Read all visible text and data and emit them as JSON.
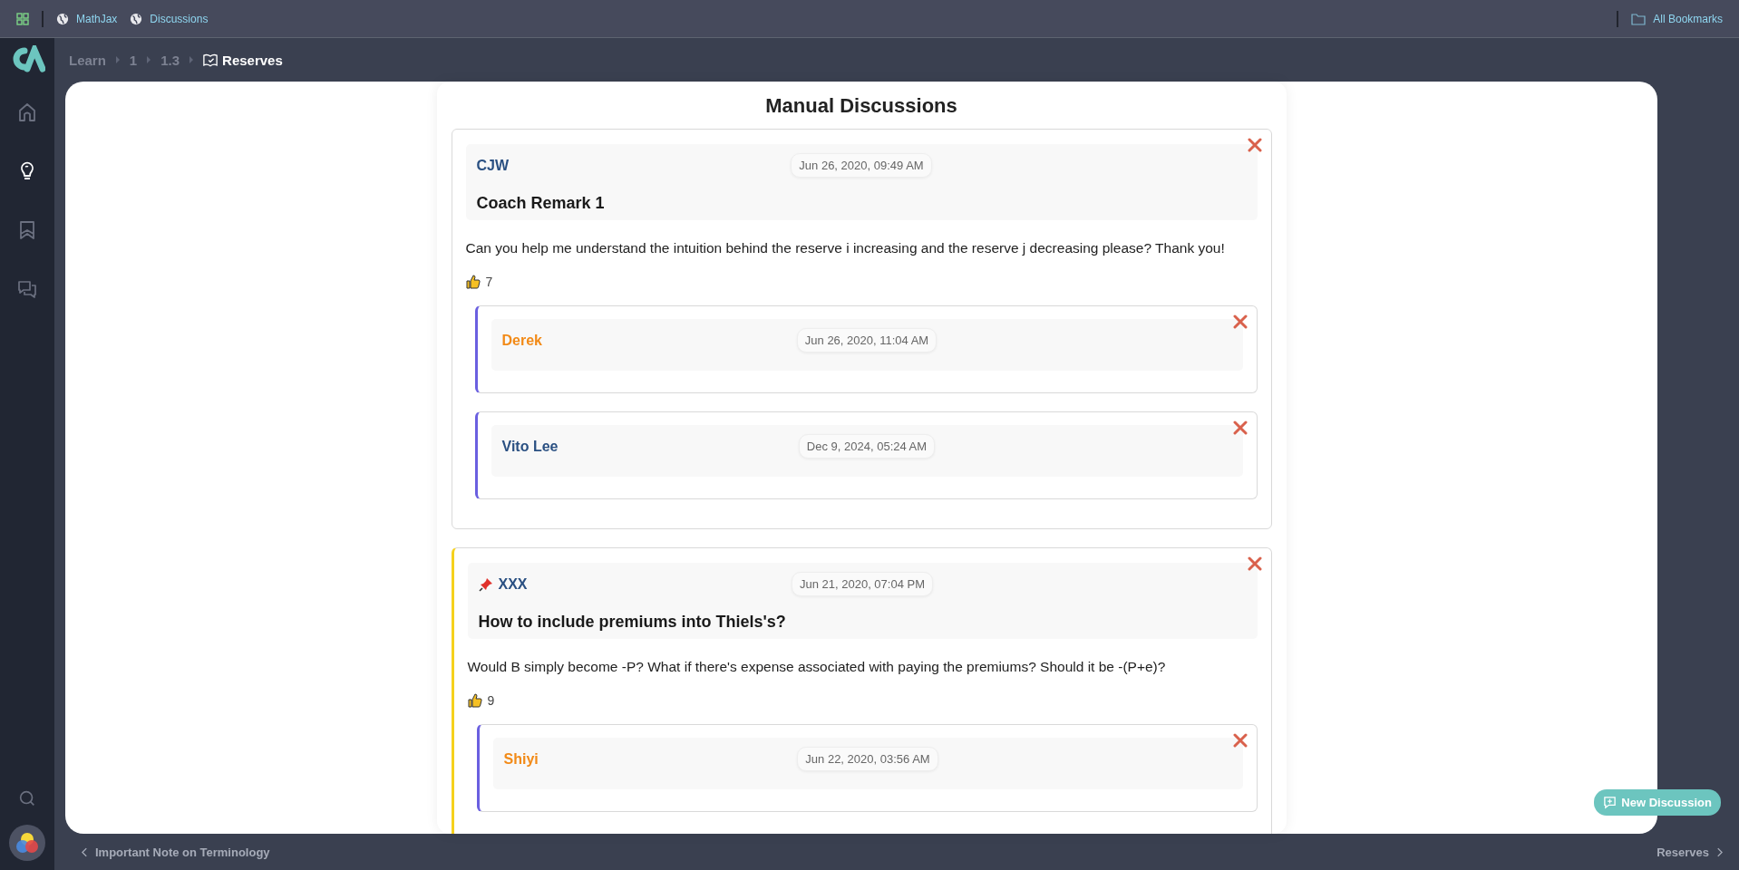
{
  "bookmarks_bar": {
    "items": [
      {
        "label": "MathJax"
      },
      {
        "label": "Discussions"
      }
    ],
    "all_bookmarks": "All Bookmarks"
  },
  "sidebar": {
    "items": [
      {
        "kind": "home",
        "selected": false
      },
      {
        "kind": "bulb",
        "selected": true
      },
      {
        "kind": "bookmark",
        "selected": false
      },
      {
        "kind": "chat",
        "selected": false
      }
    ]
  },
  "breadcrumb": {
    "items": [
      "Learn",
      "1",
      "1.3"
    ],
    "current": "Reserves"
  },
  "title": "Manual Discussions",
  "posts": [
    {
      "author": "CJW",
      "color": "#2a5082",
      "pinned": false,
      "date": "Jun 26, 2020, 09:49 AM",
      "title": "Coach Remark 1",
      "body": "Can you help me understand the intuition behind the reserve i increasing and the reserve j decreasing please? Thank you!",
      "likes": "7",
      "replies": [
        {
          "author": "Derek",
          "color": "#f28a17",
          "date": "Jun 26, 2020, 11:04 AM"
        },
        {
          "author": "Vito Lee",
          "color": "#2a5082",
          "date": "Dec 9, 2024, 05:24 AM"
        }
      ]
    },
    {
      "author": "XXX",
      "color": "#2a5082",
      "pinned": true,
      "date": "Jun 21, 2020, 07:04 PM",
      "title": "How to include premiums into Thiels's?",
      "body": "Would B simply become -P? What if there's expense associated with paying the premiums? Should it be -(P+e)?",
      "likes": "9",
      "replies": [
        {
          "author": "Shiyi",
          "color": "#f28a17",
          "date": "Jun 22, 2020, 03:56 AM"
        }
      ]
    }
  ],
  "new_discussion": "New Discussion",
  "footer": {
    "prev": "Important Note on Terminology",
    "next": "Reserves"
  }
}
